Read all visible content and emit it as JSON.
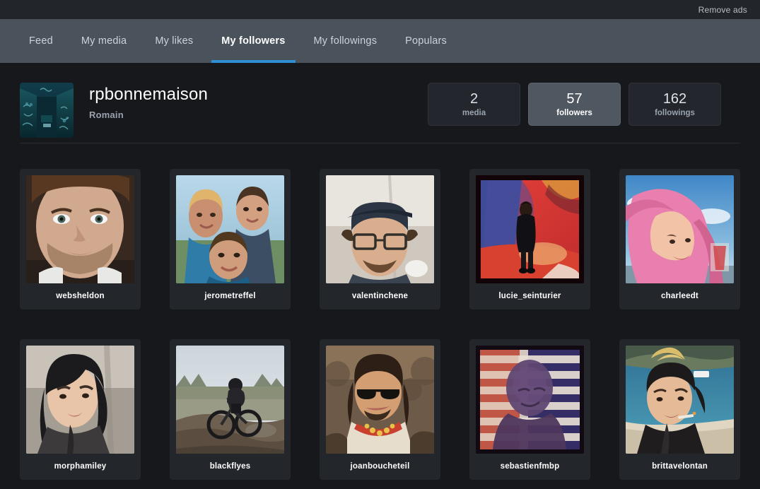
{
  "topbar": {
    "remove_ads_label": "Remove ads"
  },
  "nav": {
    "items": [
      {
        "label": "Feed",
        "active": false
      },
      {
        "label": "My media",
        "active": false
      },
      {
        "label": "My likes",
        "active": false
      },
      {
        "label": "My followers",
        "active": true
      },
      {
        "label": "My followings",
        "active": false
      },
      {
        "label": "Populars",
        "active": false
      }
    ],
    "accent_color": "#2f8fd4"
  },
  "profile": {
    "username": "rpbonnemaison",
    "fullname": "Romain",
    "avatar_icon": "profile-avatar-photo"
  },
  "stats": [
    {
      "value": "2",
      "label": "media",
      "active": false
    },
    {
      "value": "57",
      "label": "followers",
      "active": true
    },
    {
      "value": "162",
      "label": "followings",
      "active": false
    }
  ],
  "followers": [
    {
      "name": "websheldon",
      "thumb": "portrait-bearded-man"
    },
    {
      "name": "jerometreffel",
      "thumb": "family-selfie"
    },
    {
      "name": "valentinchene",
      "thumb": "man-cap-glasses"
    },
    {
      "name": "lucie_seinturier",
      "thumb": "figure-red-blue-room"
    },
    {
      "name": "charleedt",
      "thumb": "pink-hair-sky"
    },
    {
      "name": "morphamiley",
      "thumb": "dark-hair-woman"
    },
    {
      "name": "blackflyes",
      "thumb": "dirt-bike-rider"
    },
    {
      "name": "joanboucheteil",
      "thumb": "sunglasses-man-crowd"
    },
    {
      "name": "sebastienfmbp",
      "thumb": "silhouette-blinds"
    },
    {
      "name": "brittavelontan",
      "thumb": "woman-beach-cigarette"
    }
  ]
}
